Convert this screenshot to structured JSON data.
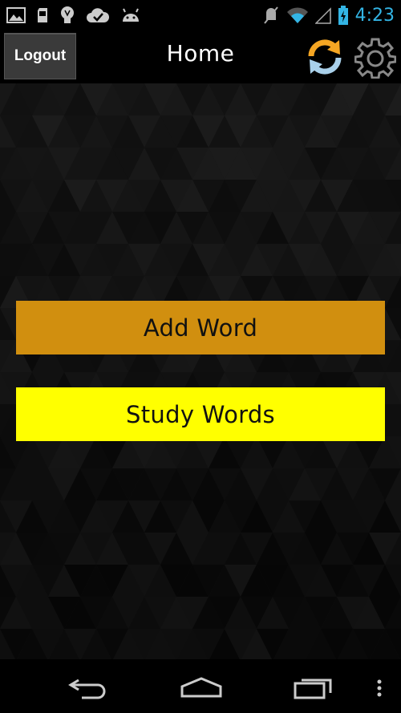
{
  "status_bar": {
    "time": "4:23",
    "icons": [
      "image-icon",
      "sd-card-icon",
      "lightbulb-icon",
      "check-cloud-icon",
      "android-icon",
      "mute-icon",
      "wifi-icon",
      "signal-icon",
      "battery-icon"
    ]
  },
  "action_bar": {
    "logout_label": "Logout",
    "title": "Home",
    "icons": [
      "refresh-icon",
      "settings-icon"
    ]
  },
  "main": {
    "add_word_label": "Add Word",
    "study_words_label": "Study Words"
  },
  "colors": {
    "add_word_bg": "#d18f0f",
    "study_words_bg": "#ffff00",
    "time_color": "#33b5e5"
  },
  "nav_bar": {
    "icons": [
      "back-icon",
      "home-icon",
      "recent-apps-icon",
      "overflow-menu-icon"
    ]
  }
}
